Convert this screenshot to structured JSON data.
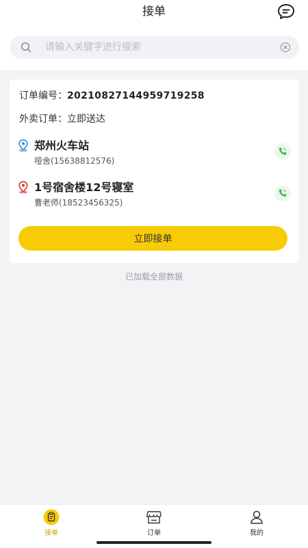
{
  "header": {
    "title": "接单",
    "message_icon": "chat-message-icon"
  },
  "search": {
    "placeholder": "请输入关键字进行搜索",
    "value": ""
  },
  "order": {
    "number_label": "订单编号：",
    "number": "20210827144959719258",
    "type_label": "外卖订单：",
    "type_value": "立即送达",
    "pickup": {
      "name": "郑州火车站",
      "contact": "哑舍(15638812576)"
    },
    "dropoff": {
      "name": "1号宿舍楼12号寝室",
      "contact": "曹老师(18523456325)"
    },
    "accept_label": "立即接单"
  },
  "list_status": "已加载全部数据",
  "tabs": [
    {
      "label": "接单",
      "icon": "receive-order-icon",
      "active": true
    },
    {
      "label": "订单",
      "icon": "order-store-icon",
      "active": false
    },
    {
      "label": "我的",
      "icon": "profile-icon",
      "active": false
    }
  ],
  "colors": {
    "accent": "#f7cc07",
    "pickup_pin": "#2a8bd8",
    "dropoff_pin": "#e0312b",
    "phone": "#3bb552"
  }
}
